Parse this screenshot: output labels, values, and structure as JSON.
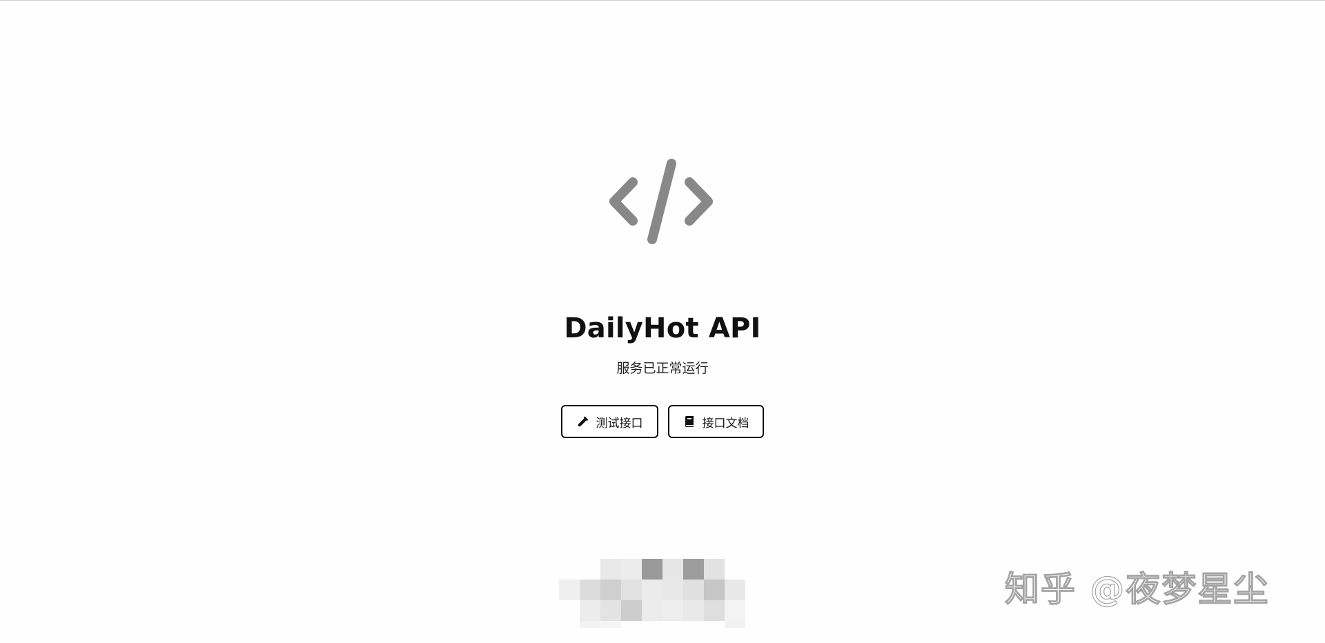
{
  "hero": {
    "icon": "code-brackets-icon",
    "icon_color": "#888888",
    "title": "DailyHot API",
    "subtitle": "服务已正常运行"
  },
  "actions": {
    "test": {
      "label": "测试接口",
      "icon": "flask-icon"
    },
    "docs": {
      "label": "接口文档",
      "icon": "book-icon"
    }
  },
  "watermark": {
    "text": "知乎 @夜梦星尘"
  },
  "colors": {
    "background": "#fefefe",
    "text": "#111111",
    "button_border": "#111111"
  }
}
